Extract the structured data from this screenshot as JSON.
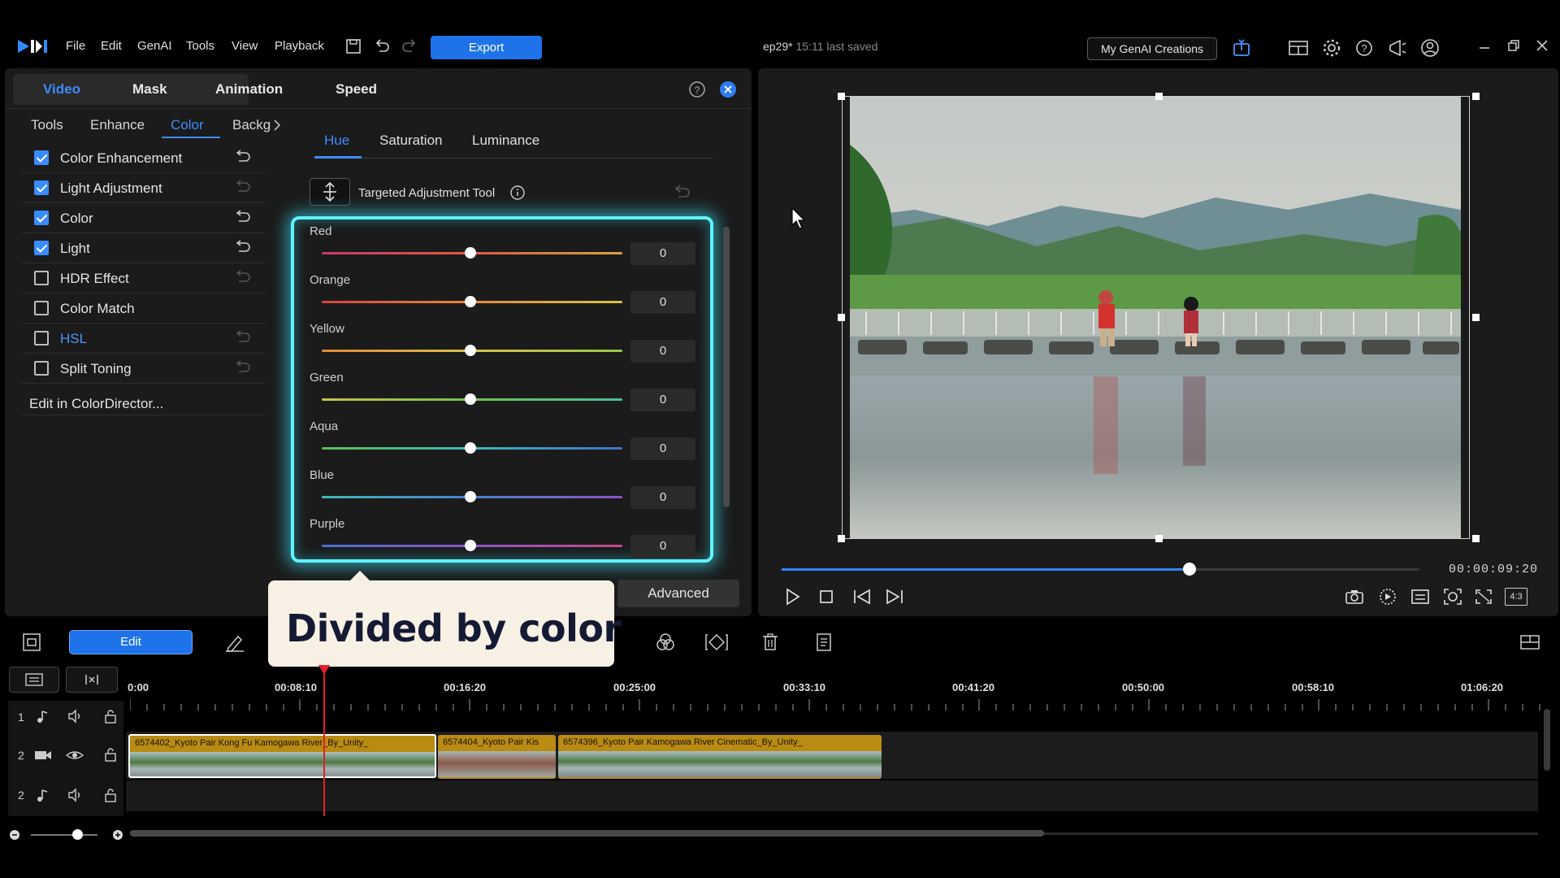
{
  "app": {
    "menu": [
      "File",
      "Edit",
      "GenAI",
      "Tools",
      "View",
      "Playback"
    ],
    "export_label": "Export",
    "project_title": "ep29*",
    "save_status": "15:11 last saved",
    "genai_label": "My GenAI Creations"
  },
  "editor": {
    "main_tabs": [
      "Video",
      "Mask",
      "Animation",
      "Speed"
    ],
    "sub_tabs": [
      "Tools",
      "Enhance",
      "Color",
      "Backg"
    ],
    "features": [
      {
        "label": "Color Enhancement",
        "checked": true
      },
      {
        "label": "Light Adjustment",
        "checked": true
      },
      {
        "label": "Color",
        "checked": true
      },
      {
        "label": "Light",
        "checked": true
      },
      {
        "label": "HDR Effect",
        "checked": false
      },
      {
        "label": "Color Match",
        "checked": false
      },
      {
        "label": "HSL",
        "checked": false
      },
      {
        "label": "Split Toning",
        "checked": false
      }
    ],
    "colordirector_link": "Edit in ColorDirector...",
    "hsl_tabs": [
      "Hue",
      "Saturation",
      "Luminance"
    ],
    "tat_label": "Targeted Adjustment Tool",
    "sliders": [
      {
        "label": "Red",
        "value": "0"
      },
      {
        "label": "Orange",
        "value": "0"
      },
      {
        "label": "Yellow",
        "value": "0"
      },
      {
        "label": "Green",
        "value": "0"
      },
      {
        "label": "Aqua",
        "value": "0"
      },
      {
        "label": "Blue",
        "value": "0"
      },
      {
        "label": "Purple",
        "value": "0"
      }
    ],
    "advanced_label": "Advanced"
  },
  "callout": {
    "text": "Divided by color"
  },
  "preview": {
    "timecode": "00:00:09:20",
    "progress": 0.64,
    "aspect_label": "4:3"
  },
  "timeline": {
    "edit_label": "Edit",
    "ruler": [
      "0:00",
      "00:08:10",
      "00:16:20",
      "00:25:00",
      "00:33:10",
      "00:41:20",
      "00:50:00",
      "00:58:10",
      "01:06:20"
    ],
    "tracks": [
      {
        "num": "1",
        "kind": "audio"
      },
      {
        "num": "2",
        "kind": "video"
      },
      {
        "num": "2",
        "kind": "audio"
      }
    ],
    "clips": [
      {
        "title": "6574402_Kyoto Pair Kong Fu Kamogawa River_By_Unity_"
      },
      {
        "title": "6574404_Kyoto Pair Kis"
      },
      {
        "title": "6574396_Kyoto Pair Kamogawa River Cinematic_By_Unity_"
      }
    ]
  },
  "colors": {
    "accent": "#3f8cff",
    "export_blue": "#1f73ea",
    "glow": "#5ff4ff",
    "clip": "#b98b13",
    "playhead": "#e21f2b"
  }
}
